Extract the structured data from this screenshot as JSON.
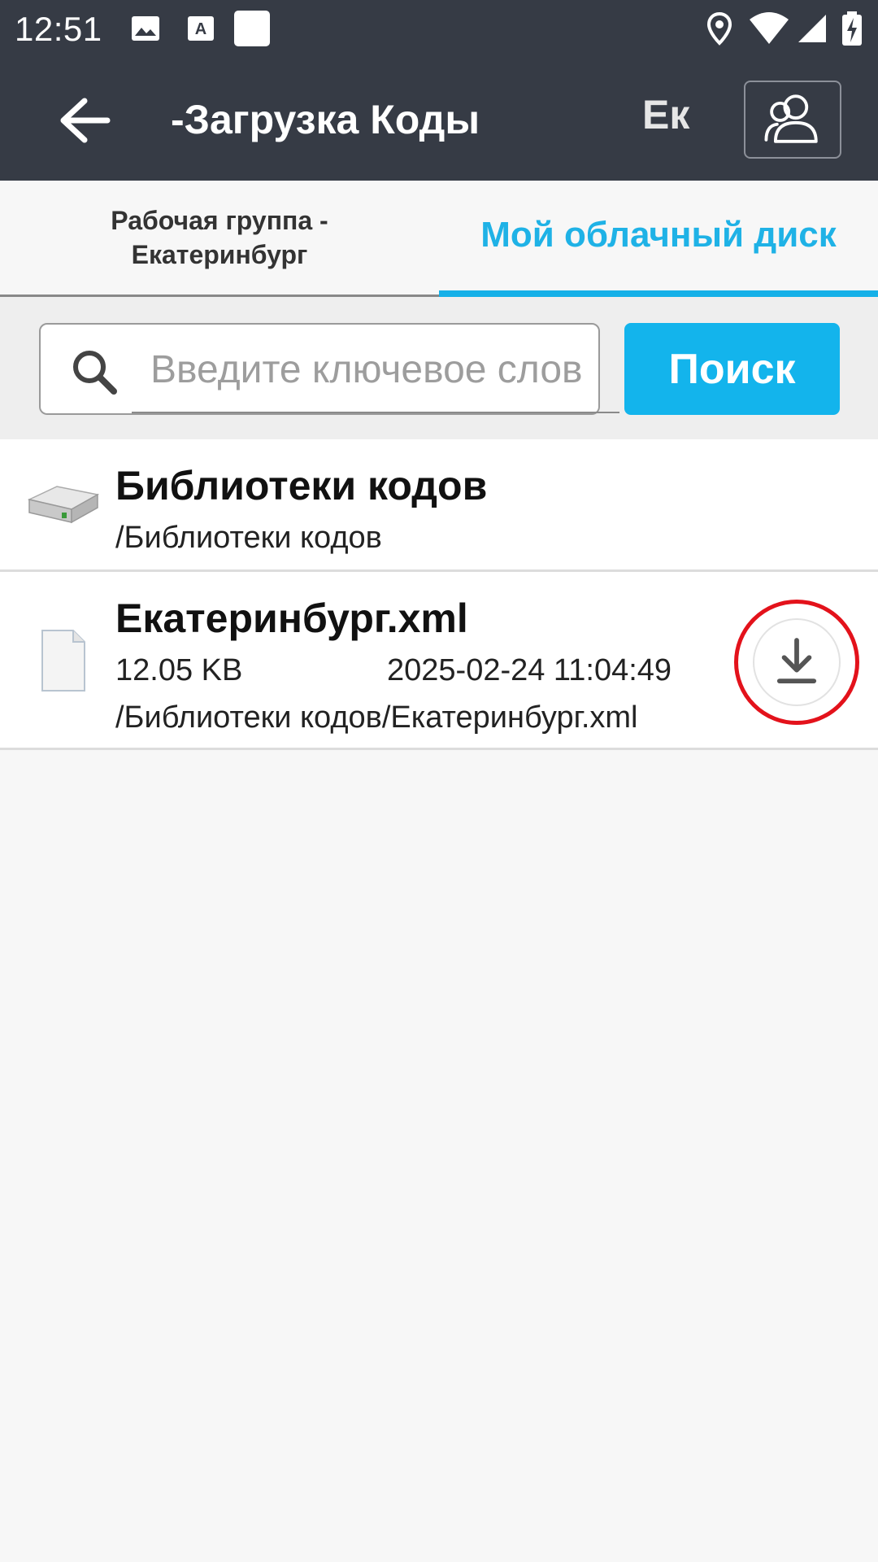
{
  "status_bar": {
    "time": "12:51",
    "left_icons": [
      "image-icon",
      "text-a-icon",
      "blank-square-icon"
    ],
    "right_icons": [
      "location-icon",
      "wifi-icon",
      "signal-icon",
      "battery-charging-icon"
    ]
  },
  "app_bar": {
    "title": "-Загрузка Коды",
    "overflow_text": "Ек",
    "back_icon": "arrow-left-icon",
    "group_icon": "users-icon"
  },
  "tabs": [
    {
      "label": "Рабочая группа - Екатеринбург",
      "selected": false
    },
    {
      "label": "Мой облачный диск",
      "selected": true
    }
  ],
  "search": {
    "placeholder": "Введите ключевое слово",
    "value": "",
    "button_label": "Поиск"
  },
  "items": [
    {
      "icon": "hard-drive-icon",
      "name": "Библиотеки кодов",
      "path": "/Библиотеки кодов"
    },
    {
      "icon": "file-icon",
      "name": "Екатеринбург.xml",
      "size": "12.05 KB",
      "date": "2025-02-24 11:04:49",
      "path": "/Библиотеки кодов/Екатеринбург.xml",
      "action_icon": "download-icon"
    }
  ],
  "colors": {
    "header_bg": "#363b45",
    "accent": "#13b4ec",
    "highlight": "#e3121b"
  }
}
